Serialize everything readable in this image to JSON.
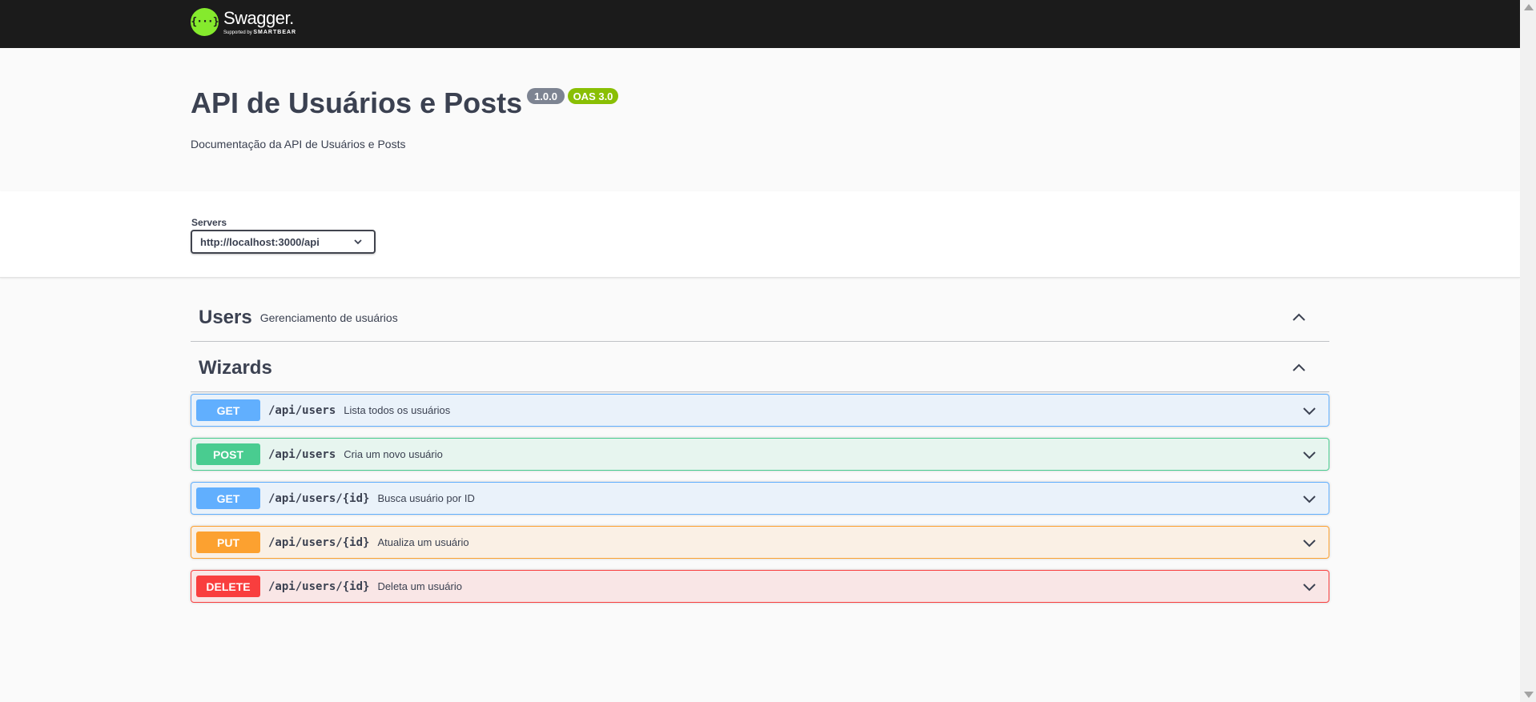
{
  "topbar": {
    "logo_icon": "{···}",
    "logo_title": "Swagger.",
    "logo_supported": "Supported by",
    "logo_brand": "SMARTBEAR"
  },
  "info": {
    "title": "API de Usuários e Posts",
    "version": "1.0.0",
    "oas": "OAS 3.0",
    "description": "Documentação da API de Usuários e Posts"
  },
  "servers": {
    "label": "Servers",
    "selected": "http://localhost:3000/api"
  },
  "tags": [
    {
      "name": "Users",
      "description": "Gerenciamento de usuários",
      "icon": "chevron-up-icon"
    },
    {
      "name": "Wizards",
      "description": "",
      "icon": "chevron-up-icon"
    }
  ],
  "operations": [
    {
      "method": "GET",
      "path": "/api/users",
      "summary": "Lista todos os usuários",
      "color": "#61affe"
    },
    {
      "method": "POST",
      "path": "/api/users",
      "summary": "Cria um novo usuário",
      "color": "#49cc90"
    },
    {
      "method": "GET",
      "path": "/api/users/{id}",
      "summary": "Busca usuário por ID",
      "color": "#61affe"
    },
    {
      "method": "PUT",
      "path": "/api/users/{id}",
      "summary": "Atualiza um usuário",
      "color": "#fca130"
    },
    {
      "method": "DELETE",
      "path": "/api/users/{id}",
      "summary": "Deleta um usuário",
      "color": "#f93e3e"
    }
  ],
  "colors": {
    "topbar_bg": "#1b1b1b",
    "logo_green": "#85ea2d",
    "version_badge": "#7d8492",
    "oas_badge": "#89bf04"
  }
}
